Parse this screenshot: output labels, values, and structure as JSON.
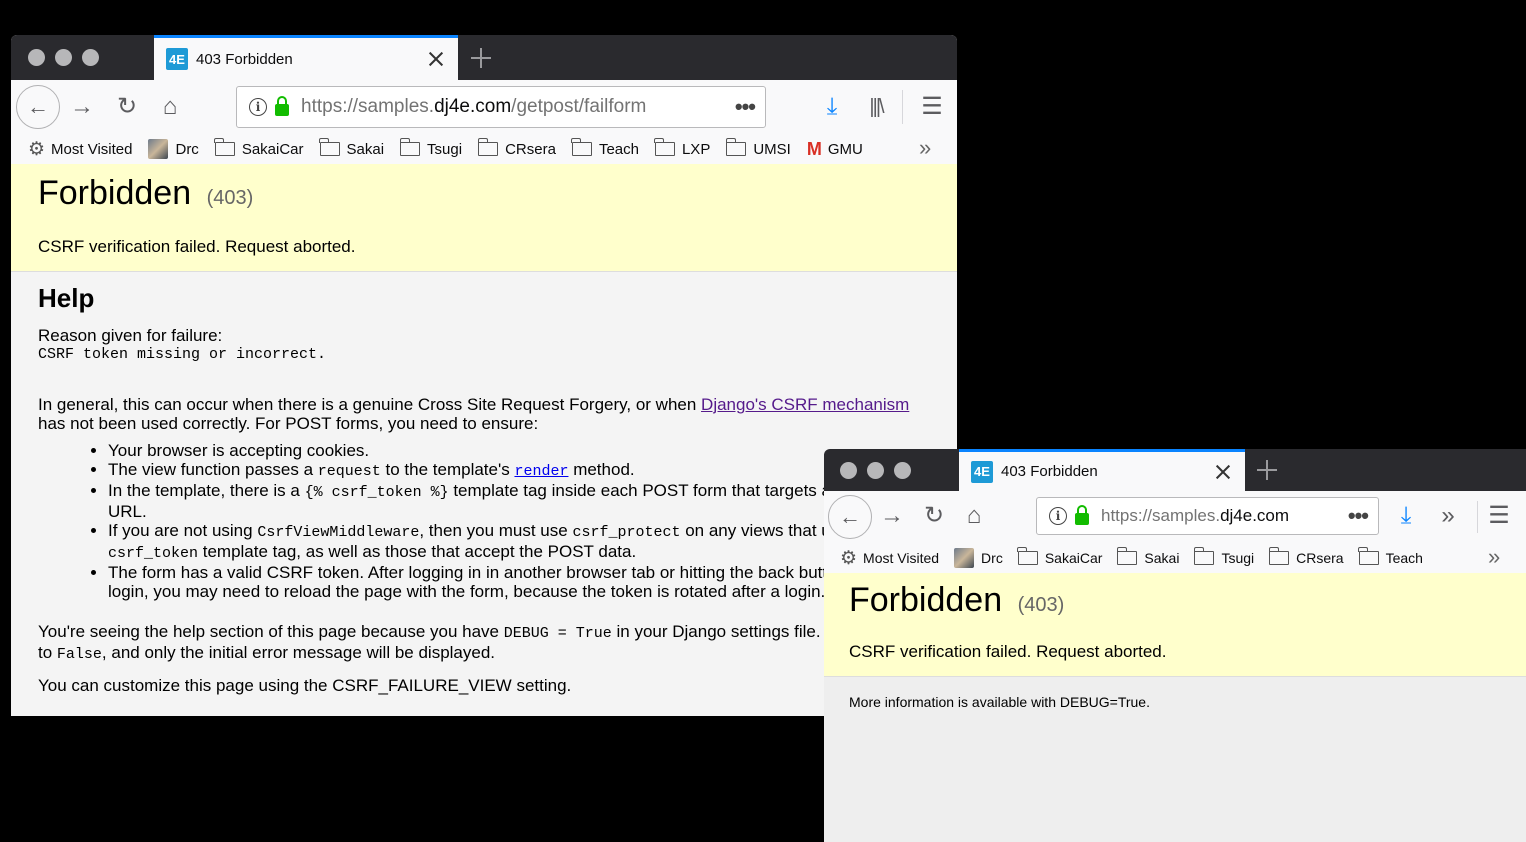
{
  "window1": {
    "tab": {
      "favicon": "4E",
      "title": "403 Forbidden"
    },
    "url": {
      "prefix": "https://samples.",
      "host": "dj4e.com",
      "path": "/getpost/failform"
    },
    "bookmarks": [
      {
        "type": "gear",
        "label": "Most Visited"
      },
      {
        "type": "avatar",
        "label": "Drc"
      },
      {
        "type": "folder",
        "label": "SakaiCar"
      },
      {
        "type": "folder",
        "label": "Sakai"
      },
      {
        "type": "folder",
        "label": "Tsugi"
      },
      {
        "type": "folder",
        "label": "CRsera"
      },
      {
        "type": "folder",
        "label": "Teach"
      },
      {
        "type": "folder",
        "label": "LXP"
      },
      {
        "type": "folder",
        "label": "UMSI"
      },
      {
        "type": "gmail",
        "label": "GMU"
      }
    ],
    "page": {
      "title": "Forbidden",
      "code": "(403)",
      "message": "CSRF verification failed. Request aborted.",
      "help_heading": "Help",
      "reason_label": "Reason given for failure:",
      "reason_code": "CSRF token missing or incorrect.",
      "general_pre": "In general, this can occur when there is a genuine Cross Site Request Forgery, or when ",
      "general_link": "Django's CSRF mechanism",
      "general_post": " has not been used correctly. For POST forms, you need to ensure:",
      "bullets": {
        "b1": "Your browser is accepting cookies.",
        "b2_pre": "The view function passes a ",
        "b2_code": "request",
        "b2_mid": " to the template's ",
        "b2_link": "render",
        "b2_post": " method.",
        "b3_pre": "In the template, there is a ",
        "b3_code": "{% csrf_token %}",
        "b3_post": " template tag inside each POST form that targets an internal URL.",
        "b4_pre": "If you are not using ",
        "b4_code1": "CsrfViewMiddleware",
        "b4_mid": ", then you must use ",
        "b4_code2": "csrf_protect",
        "b4_mid2": " on any views that use the ",
        "b4_code3": "csrf_token",
        "b4_post": " template tag, as well as those that accept the POST data.",
        "b5": "The form has a valid CSRF token. After logging in in another browser tab or hitting the back button after a login, you may need to reload the page with the form, because the token is rotated after a login."
      },
      "debug_pre": "You're seeing the help section of this page because you have ",
      "debug_code1": "DEBUG = True",
      "debug_mid": " in your Django settings file. Change that to ",
      "debug_code2": "False",
      "debug_post": ", and only the initial error message will be displayed.",
      "custom": "You can customize this page using the CSRF_FAILURE_VIEW setting."
    }
  },
  "window2": {
    "tab": {
      "favicon": "4E",
      "title": "403 Forbidden"
    },
    "url": {
      "prefix": "https://samples.",
      "host": "dj4e.com",
      "path": ""
    },
    "bookmarks": [
      {
        "type": "gear",
        "label": "Most Visited"
      },
      {
        "type": "avatar",
        "label": "Drc"
      },
      {
        "type": "folder",
        "label": "SakaiCar"
      },
      {
        "type": "folder",
        "label": "Sakai"
      },
      {
        "type": "folder",
        "label": "Tsugi"
      },
      {
        "type": "folder",
        "label": "CRsera"
      },
      {
        "type": "folder",
        "label": "Teach"
      }
    ],
    "page": {
      "title": "Forbidden",
      "code": "(403)",
      "message": "CSRF verification failed. Request aborted.",
      "info": "More information is available with DEBUG=True."
    }
  },
  "colors": {
    "tabbar": "#2a2a2e",
    "accent": "#0a84ff",
    "summary_bg": "#ffffcc",
    "lock": "#12bc00",
    "download": "#0a84ff"
  }
}
